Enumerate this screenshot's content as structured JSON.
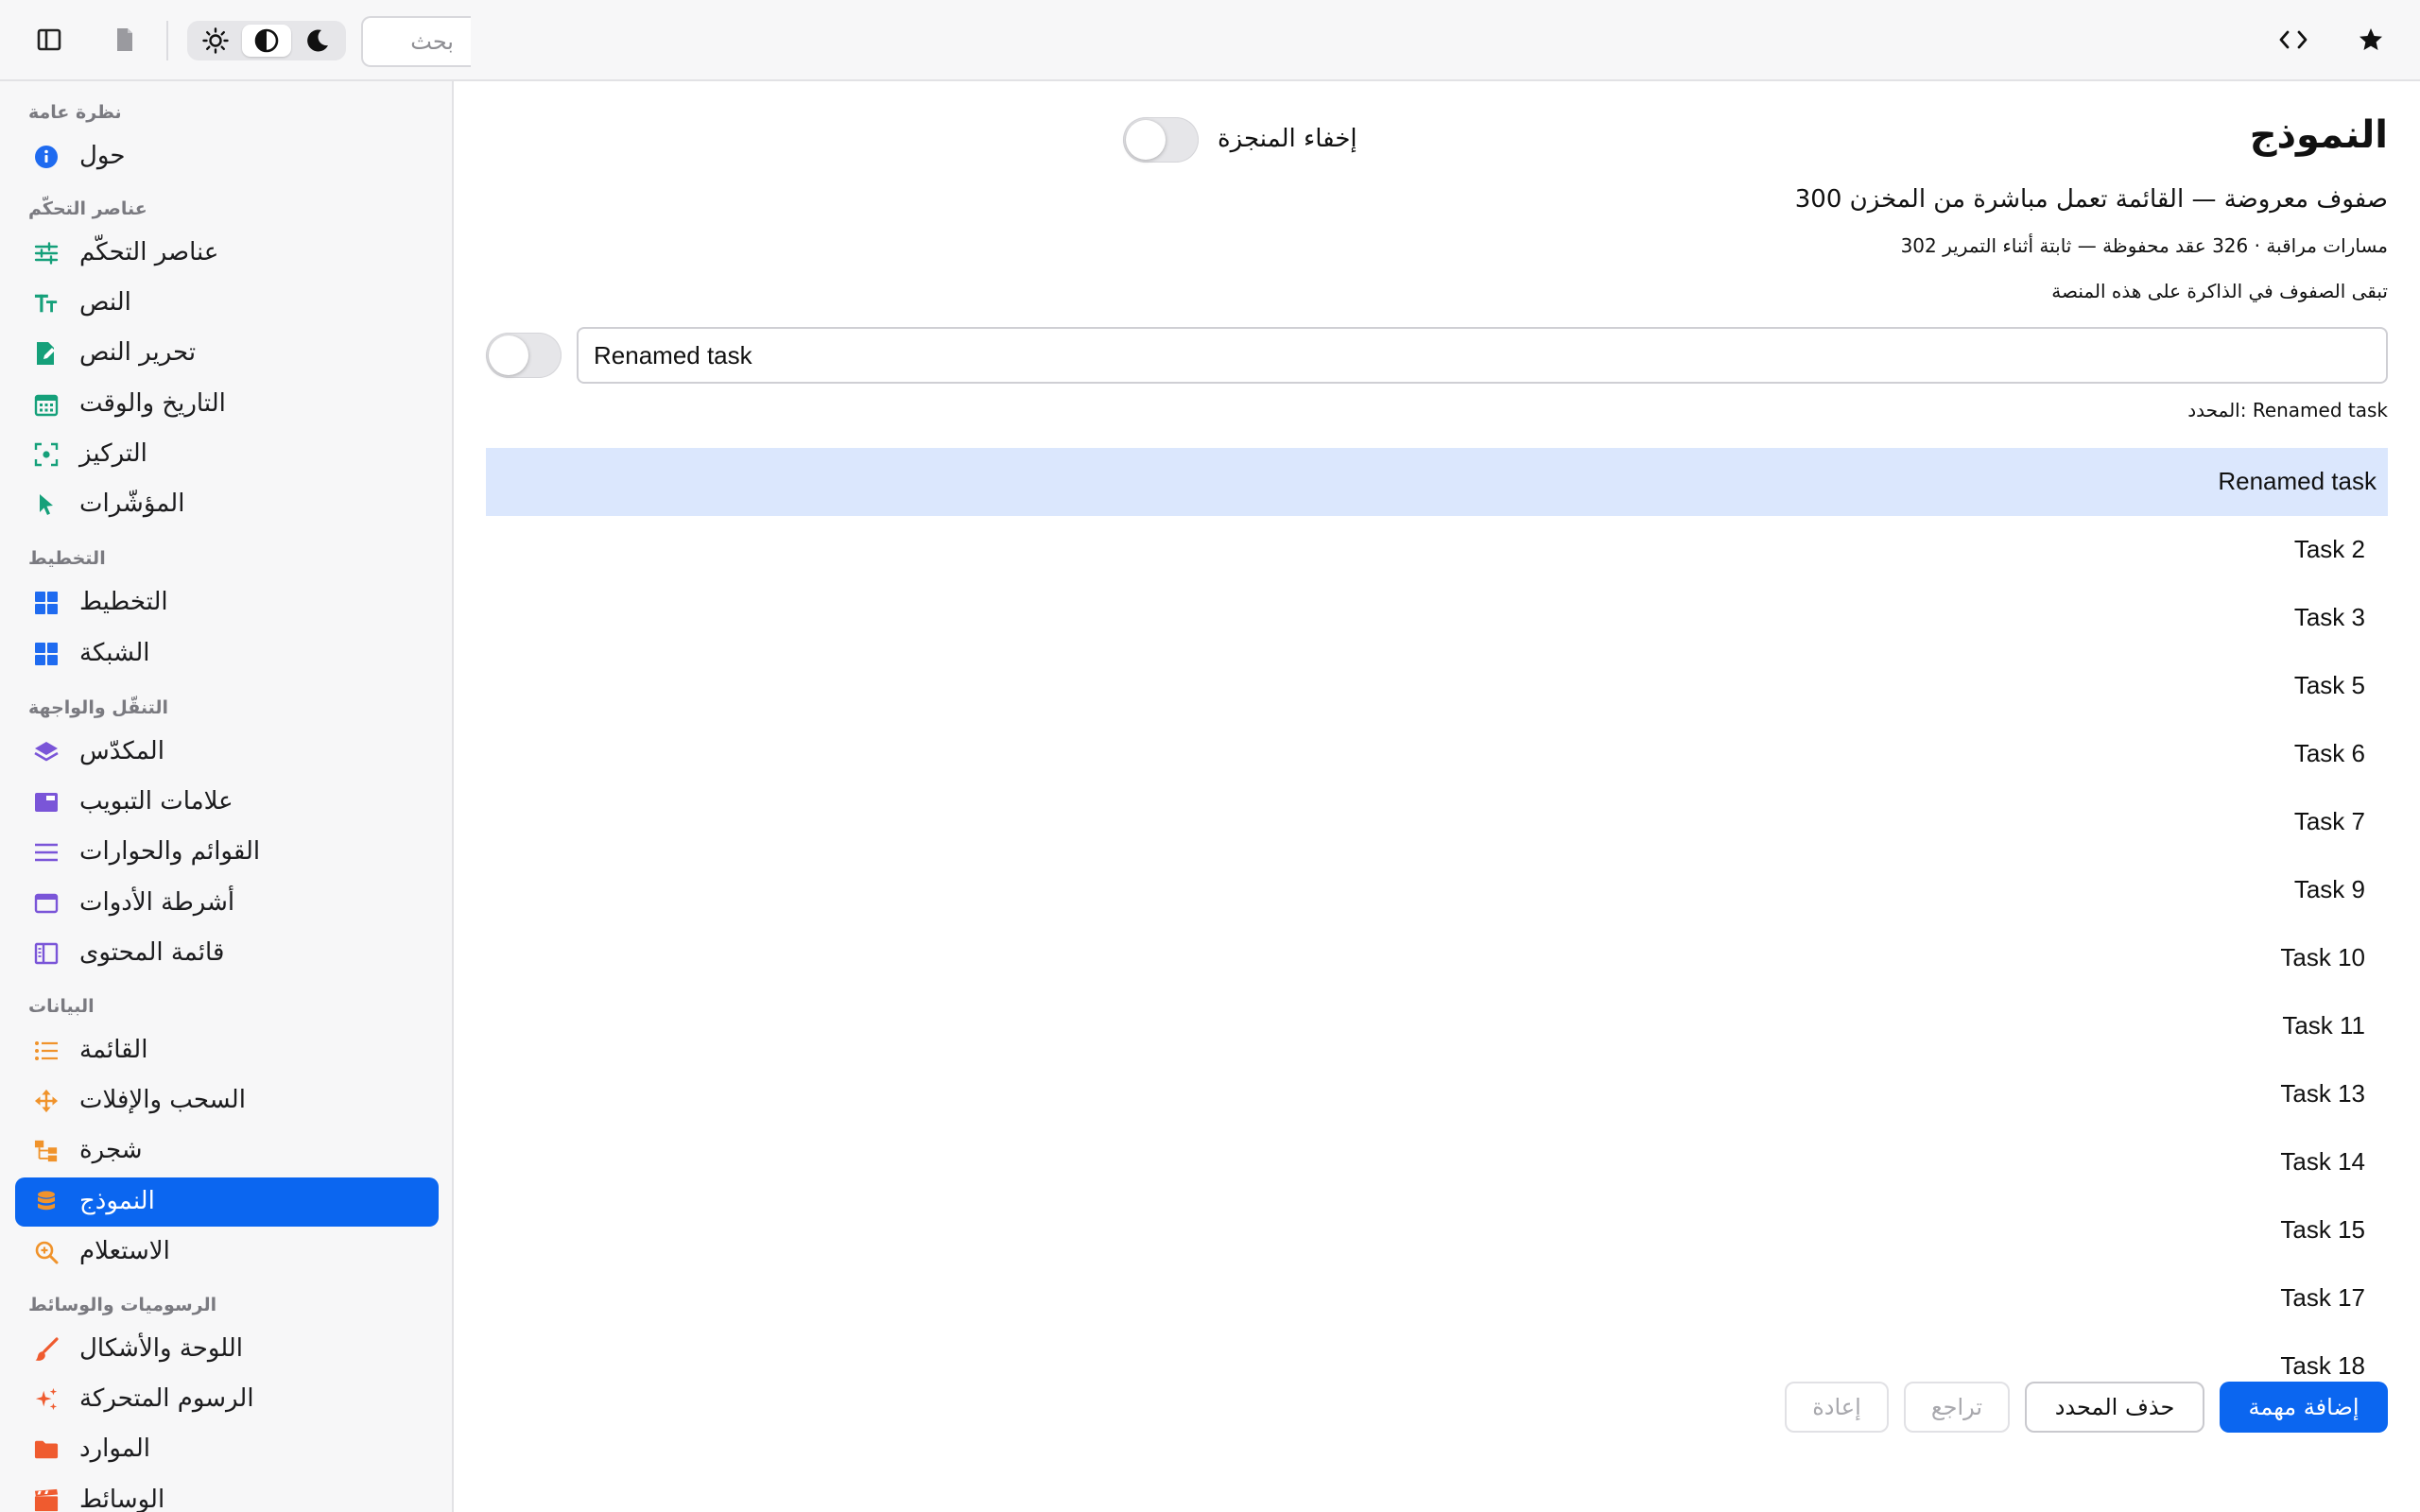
{
  "toolbar": {
    "search_placeholder": "بحث",
    "theme_options": [
      "light",
      "auto",
      "dark"
    ],
    "active_theme": "auto"
  },
  "sidebar": {
    "sections": [
      {
        "title": "نظرة عامة",
        "items": [
          {
            "label": "حول",
            "icon": "info-icon",
            "color": "#1f6bf0"
          }
        ]
      },
      {
        "title": "عناصر التحكّم",
        "items": [
          {
            "label": "عناصر التحكّم",
            "icon": "sliders-icon",
            "color": "#15a07a"
          },
          {
            "label": "النص",
            "icon": "text-size-icon",
            "color": "#15a07a"
          },
          {
            "label": "تحرير النص",
            "icon": "edit-document-icon",
            "color": "#15a07a"
          },
          {
            "label": "التاريخ والوقت",
            "icon": "calendar-icon",
            "color": "#15a07a"
          },
          {
            "label": "التركيز",
            "icon": "focus-icon",
            "color": "#15a07a"
          },
          {
            "label": "المؤشّرات",
            "icon": "cursor-icon",
            "color": "#15a07a"
          }
        ]
      },
      {
        "title": "التخطيط",
        "items": [
          {
            "label": "التخطيط",
            "icon": "layout-icon",
            "color": "#1f6bf0"
          },
          {
            "label": "الشبكة",
            "icon": "grid-icon",
            "color": "#1f6bf0"
          }
        ]
      },
      {
        "title": "التنقّل والواجهة",
        "items": [
          {
            "label": "المكدّس",
            "icon": "stack-icon",
            "color": "#7a55d8"
          },
          {
            "label": "علامات التبويب",
            "icon": "tabs-icon",
            "color": "#7a55d8"
          },
          {
            "label": "القوائم والحوارات",
            "icon": "menu-icon",
            "color": "#7a55d8"
          },
          {
            "label": "أشرطة الأدوات",
            "icon": "toolbar-icon",
            "color": "#7a55d8"
          },
          {
            "label": "قائمة المحتوى",
            "icon": "sidebar-layout-icon",
            "color": "#7a55d8"
          }
        ]
      },
      {
        "title": "البيانات",
        "items": [
          {
            "label": "القائمة",
            "icon": "list-icon",
            "color": "#f0932b"
          },
          {
            "label": "السحب والإفلات",
            "icon": "move-arrows-icon",
            "color": "#f0932b"
          },
          {
            "label": "شجرة",
            "icon": "tree-icon",
            "color": "#f0932b"
          },
          {
            "label": "النموذج",
            "icon": "database-icon",
            "color": "#f0932b",
            "active": true
          },
          {
            "label": "الاستعلام",
            "icon": "zoom-search-icon",
            "color": "#f0932b"
          }
        ]
      },
      {
        "title": "الرسوميات والوسائط",
        "items": [
          {
            "label": "اللوحة والأشكال",
            "icon": "brush-icon",
            "color": "#ef5b2f"
          },
          {
            "label": "الرسوم المتحركة",
            "icon": "sparkles-icon",
            "color": "#ef5b2f"
          },
          {
            "label": "الموارد",
            "icon": "folder-icon",
            "color": "#ef5b2f"
          },
          {
            "label": "الوسائط",
            "icon": "film-icon",
            "color": "#ef5b2f"
          }
        ]
      }
    ]
  },
  "main": {
    "title": "النموذج",
    "hide_completed_label": "إخفاء المنجزة",
    "hide_completed_on": false,
    "info_line_1": "صفوف معروضة — القائمة تعمل مباشرة من المخزن 300",
    "info_line_2": "مسارات مراقبة · 326 عقد محفوظة — ثابتة أثناء التمرير 302",
    "info_line_3": "تبقى الصفوف في الذاكرة على هذه المنصة",
    "rename_value": "Renamed task",
    "rename_toggle_on": false,
    "selected_text": "المحدد: Renamed task",
    "rows": [
      {
        "label": "Renamed task",
        "selected": true
      },
      {
        "label": "Task 2"
      },
      {
        "label": "Task 3"
      },
      {
        "label": "Task 5"
      },
      {
        "label": "Task 6"
      },
      {
        "label": "Task 7"
      },
      {
        "label": "Task 9"
      },
      {
        "label": "Task 10"
      },
      {
        "label": "Task 11"
      },
      {
        "label": "Task 13"
      },
      {
        "label": "Task 14"
      },
      {
        "label": "Task 15"
      },
      {
        "label": "Task 17"
      },
      {
        "label": "Task 18"
      }
    ],
    "buttons": {
      "add": "إضافة مهمة",
      "delete": "حذف المحدد",
      "undo": "تراجع",
      "redo": "إعادة"
    }
  },
  "colors": {
    "accent": "#0b66f0",
    "selected_row": "#dbe7fd"
  }
}
